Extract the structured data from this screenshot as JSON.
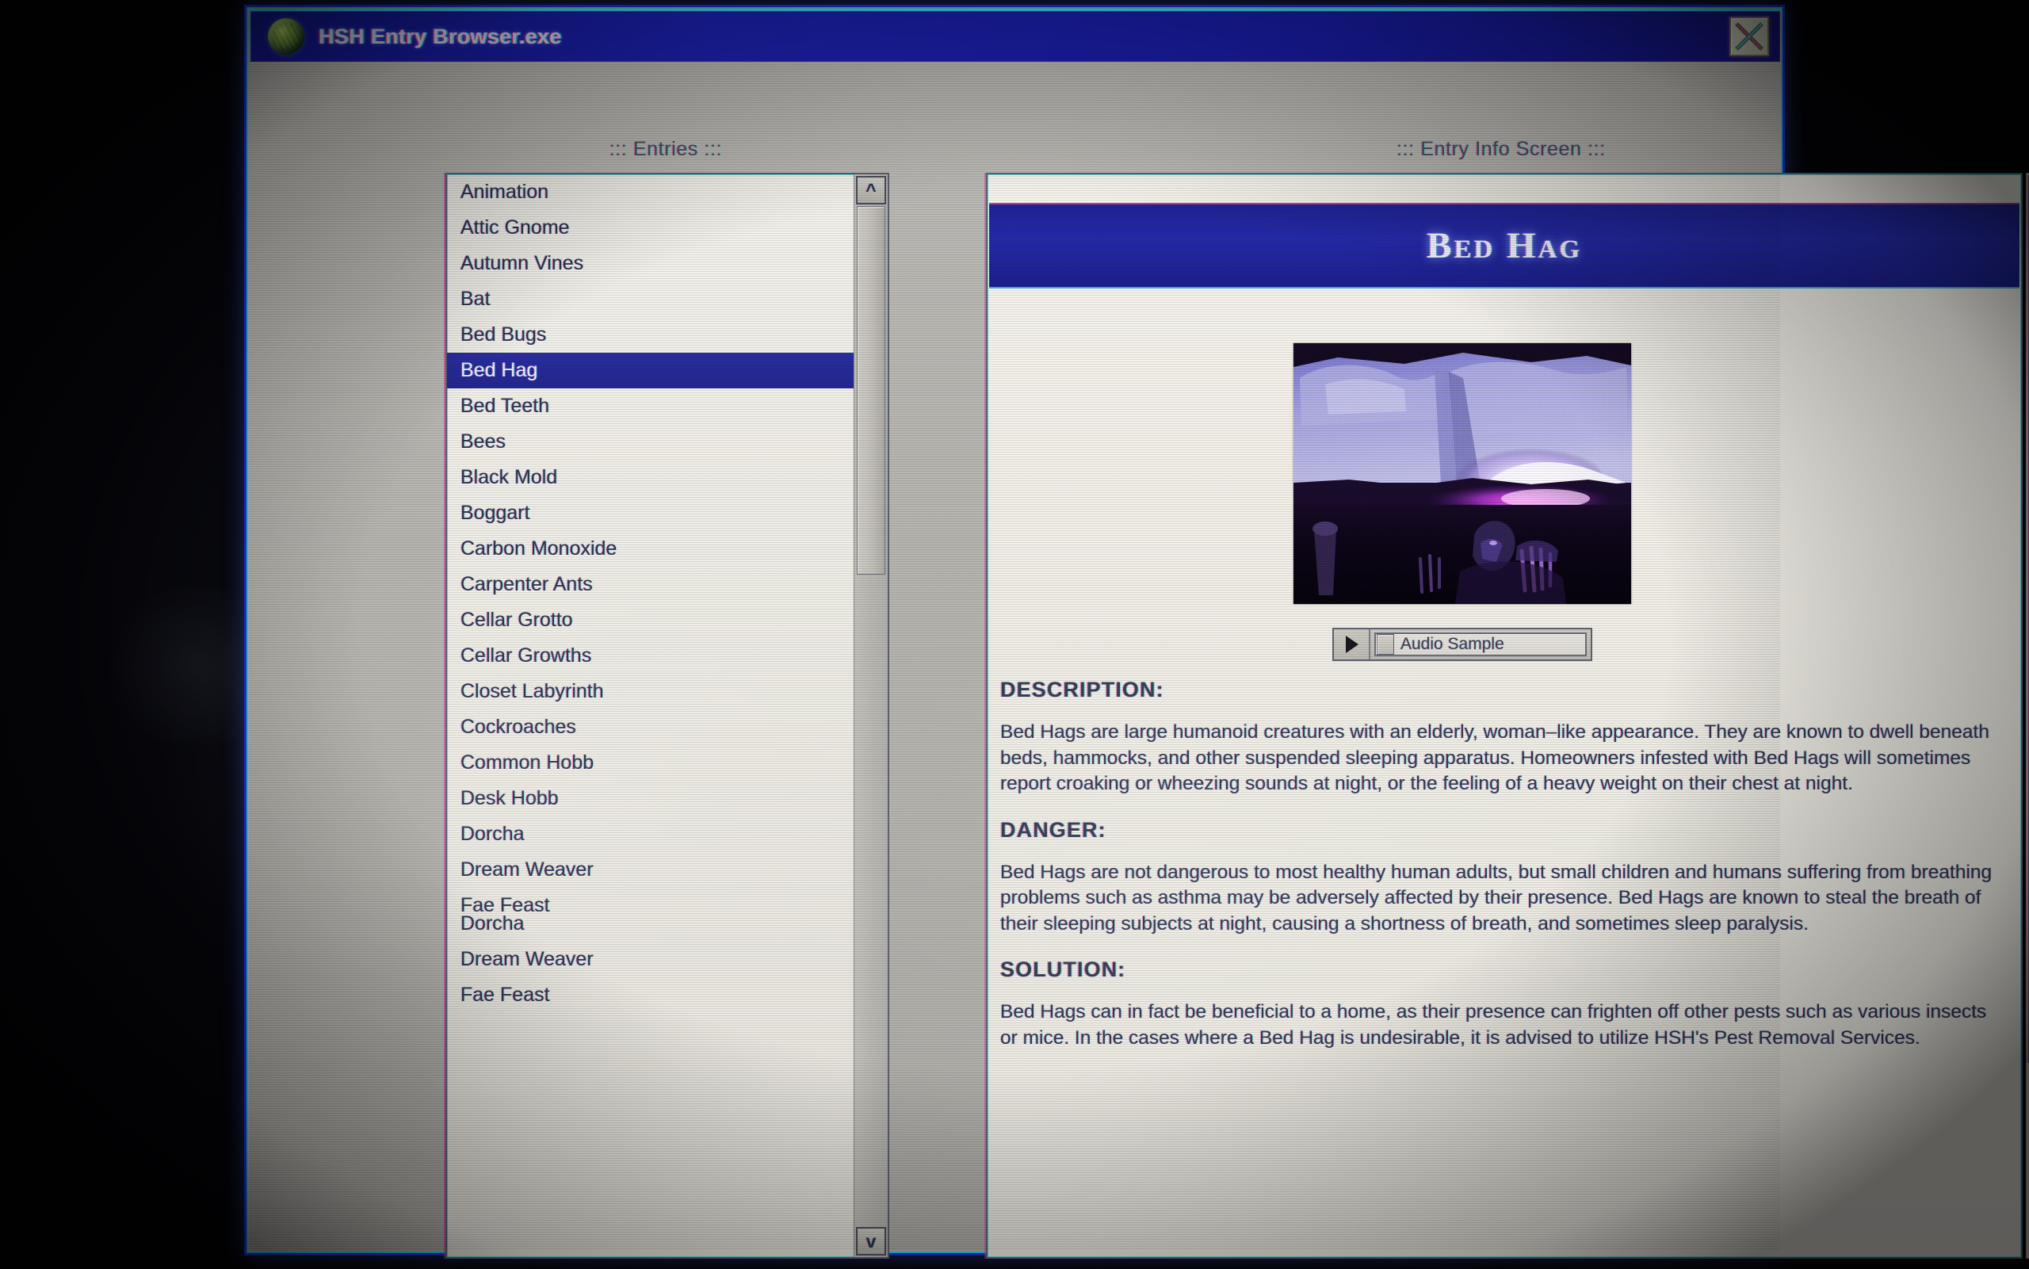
{
  "window": {
    "title": "HSH Entry Browser.exe",
    "icon": "brain-globe-icon",
    "close_label": "X",
    "accent_blue": "#1c22b4",
    "border_cyan": "#31d2e8",
    "highlight_navy": "#2a2ea0"
  },
  "entries_panel": {
    "heading": "::: Entries :::",
    "scroll_up_label": "^",
    "scroll_down_label": "v",
    "selected": "Bed Hag",
    "items": [
      {
        "label": "Animation",
        "selected": false
      },
      {
        "label": "Attic Gnome",
        "selected": false
      },
      {
        "label": "Autumn Vines",
        "selected": false
      },
      {
        "label": "Bat",
        "selected": false
      },
      {
        "label": "Bed Bugs",
        "selected": false
      },
      {
        "label": "Bed Hag",
        "selected": true
      },
      {
        "label": "Bed Teeth",
        "selected": false
      },
      {
        "label": "Bees",
        "selected": false
      },
      {
        "label": "Black Mold",
        "selected": false
      },
      {
        "label": "Boggart",
        "selected": false
      },
      {
        "label": "Carbon Monoxide",
        "selected": false
      },
      {
        "label": "Carpenter Ants",
        "selected": false
      },
      {
        "label": "Cellar Grotto",
        "selected": false
      },
      {
        "label": "Cellar Growths",
        "selected": false
      },
      {
        "label": "Closet Labyrinth",
        "selected": false
      },
      {
        "label": "Cockroaches",
        "selected": false
      },
      {
        "label": "Common Hobb",
        "selected": false
      },
      {
        "label": "Desk Hobb",
        "selected": false
      },
      {
        "label": "Dorcha",
        "selected": false
      },
      {
        "label": "Dream Weaver",
        "selected": false
      },
      {
        "label": "Fae Feast",
        "selected": false
      },
      {
        "label": "Dorcha",
        "selected": false,
        "glitch": true
      },
      {
        "label": "Dream Weaver",
        "selected": false
      },
      {
        "label": "Fae Feast",
        "selected": false
      }
    ]
  },
  "info_panel": {
    "heading": "::: Entry Info Screen :::",
    "entry_title": "Bed Hag",
    "photo_caption": "bed-hag-night-vision-photo",
    "audio": {
      "play_label": "play-triangle",
      "label": "Audio Sample"
    },
    "sections": [
      {
        "heading": "DESCRIPTION:",
        "body": "Bed Hags are large humanoid creatures with an elderly, woman–like appearance. They are known to dwell beneath beds, hammocks, and other suspended sleeping apparatus. Homeowners infested with Bed Hags will sometimes report croaking or wheezing sounds at night, or the feeling of a heavy weight on their chest at night."
      },
      {
        "heading": "DANGER:",
        "body": "Bed Hags are not dangerous to most healthy human adults, but small children and humans suffering from breathing problems such as asthma may be adversely affected by their presence. Bed Hags are known to steal the breath of their sleeping subjects at night, causing a shortness of breath, and sometimes sleep paralysis."
      },
      {
        "heading": "SOLUTION:",
        "body": "Bed Hags can in fact be beneficial to a home, as their presence can frighten off other pests such as various insects or mice. In the cases where a Bed Hag is undesirable, it is advised to utilize HSH's Pest Removal Services."
      }
    ]
  }
}
